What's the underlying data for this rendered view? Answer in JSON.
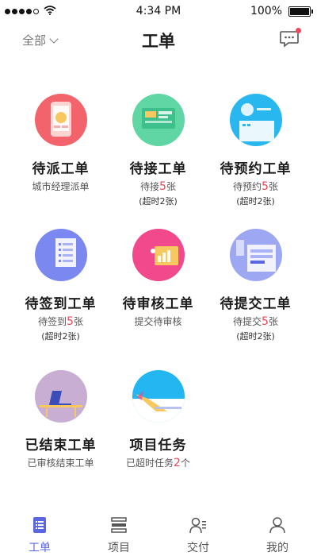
{
  "status_bar": {
    "time": "4:34 PM",
    "battery": "100%"
  },
  "header": {
    "filter_label": "全部",
    "title": "工单"
  },
  "items": [
    {
      "name": "待派工单",
      "sub_prefix": "城市经理派单",
      "count": "",
      "sub_suffix": "",
      "note": "",
      "color": "#f2636b"
    },
    {
      "name": "待接工单",
      "sub_prefix": "待接",
      "count": "5",
      "sub_suffix": "张",
      "note": "(超时2张)",
      "color": "#5fd6a3"
    },
    {
      "name": "待预约工单",
      "sub_prefix": "待预约",
      "count": "5",
      "sub_suffix": "张",
      "note": "(超时2张)",
      "color": "#28b7ef"
    },
    {
      "name": "待签到工单",
      "sub_prefix": "待签到",
      "count": "5",
      "sub_suffix": "张",
      "note": "(超时2张)",
      "color": "#7b88f0"
    },
    {
      "name": "待审核工单",
      "sub_prefix": "提交待审核",
      "count": "",
      "sub_suffix": "",
      "note": "",
      "color": "#f2498c"
    },
    {
      "name": "待提交工单",
      "sub_prefix": "待提交",
      "count": "5",
      "sub_suffix": "张",
      "note": "(超时2张)",
      "color": "#9ea8f2"
    },
    {
      "name": "已结束工单",
      "sub_prefix": "已审核结束工单",
      "count": "",
      "sub_suffix": "",
      "note": "",
      "color": "#c9aed3"
    },
    {
      "name": "项目任务",
      "sub_prefix": "已超时任务",
      "count": "2",
      "sub_suffix": "个",
      "note": "",
      "color": "#24b6f0"
    }
  ],
  "tabs": [
    {
      "label": "工单",
      "icon": "workorder-icon",
      "active": true
    },
    {
      "label": "项目",
      "icon": "project-icon",
      "active": false
    },
    {
      "label": "交付",
      "icon": "delivery-icon",
      "active": false
    },
    {
      "label": "我的",
      "icon": "profile-icon",
      "active": false
    }
  ],
  "colors": {
    "accent": "#5b66e2",
    "highlight": "#f0475a"
  }
}
